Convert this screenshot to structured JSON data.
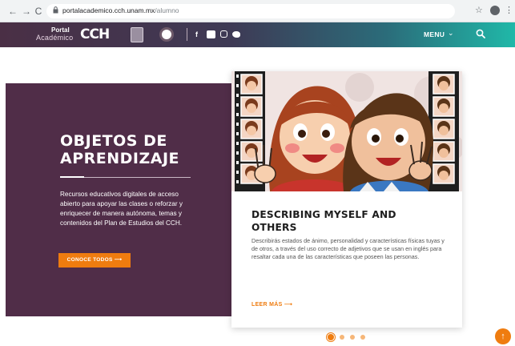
{
  "browser": {
    "back": "←",
    "forward": "→",
    "reload": "C",
    "url_host": "portalacademico.cch.unam.mx",
    "url_path": "/alumno",
    "star": "☆",
    "kebab": "⋮"
  },
  "header": {
    "logo_portal": "Portal",
    "logo_academico": "Académico",
    "logo_cch": "CCH",
    "social_fb": "f",
    "menu_label": "MENU",
    "menu_chevron": "⌄"
  },
  "hero": {
    "title_line1": "OBJETOS DE",
    "title_line2": "APRENDIZAJE",
    "description": "Recursos educativos digitales de acceso abierto para apoyar las clases o reforzar y enriquecer de manera autónoma, temas y contenidos del Plan de Estudios del CCH.",
    "cta_label": "CONOCE TODOS  ⟶"
  },
  "card": {
    "title_line1": "DESCRIBING MYSELF AND",
    "title_line2": "OTHERS",
    "description": "Describirás estados de ánimo, personalidad y características físicas tuyas y de otros, a través del uso correcto de adjetivos que se usan en inglés para resaltar cada una de las características que poseen las personas.",
    "link_label": "LEER MÁS ⟶"
  },
  "carousel": {
    "slide_count": 4,
    "active_index": 0
  },
  "scroll_top": "↑",
  "colors": {
    "hero_bg": "#502d48",
    "accent": "#ef7c0f",
    "header_start": "#4a2f45",
    "header_end": "#20b8a8"
  }
}
